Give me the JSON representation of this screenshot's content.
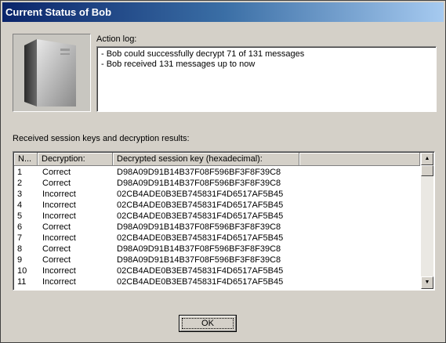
{
  "window": {
    "title": "Current Status of Bob"
  },
  "computer_image": {
    "icon": "computer-tower-icon"
  },
  "action_log": {
    "label": "Action log:",
    "lines": [
      "- Bob could successfully decrypt 71 of 131 messages",
      "- Bob received 131 messages up to now"
    ]
  },
  "results": {
    "label": "Received session keys and decryption results:",
    "columns": [
      "N...",
      "Decryption:",
      "Decrypted session key (hexadecimal):"
    ],
    "rows": [
      {
        "n": "1",
        "decryption": "Correct",
        "key": "D98A09D91B14B37F08F596BF3F8F39C8"
      },
      {
        "n": "2",
        "decryption": "Correct",
        "key": "D98A09D91B14B37F08F596BF3F8F39C8"
      },
      {
        "n": "3",
        "decryption": "Incorrect",
        "key": "02CB4ADE0B3EB745831F4D6517AF5B45"
      },
      {
        "n": "4",
        "decryption": "Incorrect",
        "key": "02CB4ADE0B3EB745831F4D6517AF5B45"
      },
      {
        "n": "5",
        "decryption": "Incorrect",
        "key": "02CB4ADE0B3EB745831F4D6517AF5B45"
      },
      {
        "n": "6",
        "decryption": "Correct",
        "key": "D98A09D91B14B37F08F596BF3F8F39C8"
      },
      {
        "n": "7",
        "decryption": "Incorrect",
        "key": "02CB4ADE0B3EB745831F4D6517AF5B45"
      },
      {
        "n": "8",
        "decryption": "Correct",
        "key": "D98A09D91B14B37F08F596BF3F8F39C8"
      },
      {
        "n": "9",
        "decryption": "Correct",
        "key": "D98A09D91B14B37F08F596BF3F8F39C8"
      },
      {
        "n": "10",
        "decryption": "Incorrect",
        "key": "02CB4ADE0B3EB745831F4D6517AF5B45"
      },
      {
        "n": "11",
        "decryption": "Incorrect",
        "key": "02CB4ADE0B3EB745831F4D6517AF5B45"
      }
    ]
  },
  "buttons": {
    "ok_label": "OK"
  },
  "colors": {
    "title_gradient_start": "#0a246a",
    "title_gradient_end": "#a6caf0",
    "face": "#d4d0c8"
  }
}
